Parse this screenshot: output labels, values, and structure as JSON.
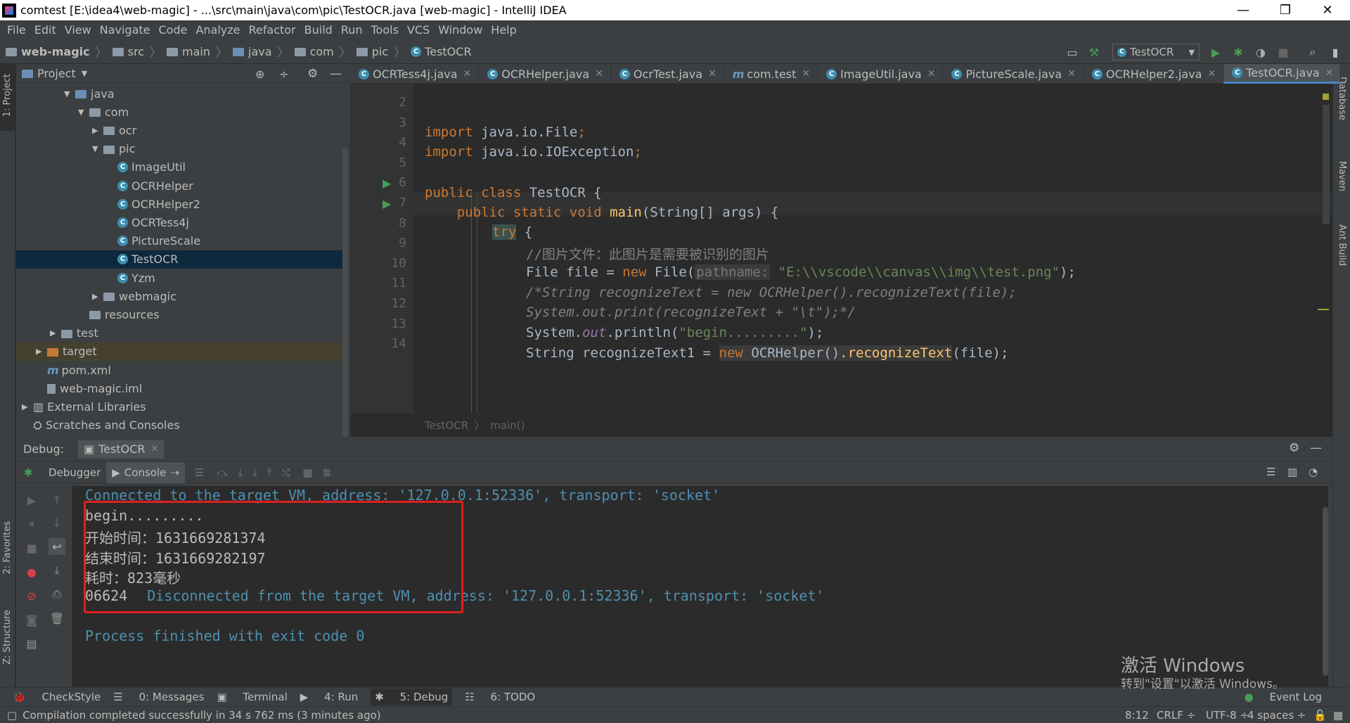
{
  "window": {
    "title": "comtest [E:\\idea4\\web-magic] - ...\\src\\main\\java\\com\\pic\\TestOCR.java [web-magic] - IntelliJ IDEA"
  },
  "menu": [
    "File",
    "Edit",
    "View",
    "Navigate",
    "Code",
    "Analyze",
    "Refactor",
    "Build",
    "Run",
    "Tools",
    "VCS",
    "Window",
    "Help"
  ],
  "breadcrumb": [
    "web-magic",
    "src",
    "main",
    "java",
    "com",
    "pic",
    "TestOCR"
  ],
  "run_config": "TestOCR",
  "left_stripe": {
    "project": "1: Project",
    "favorites": "2: Favorites",
    "structure": "Z: Structure"
  },
  "right_stripe": {
    "database": "Database",
    "maven": "Maven",
    "ant": "Ant Build"
  },
  "project_panel": {
    "title": "Project",
    "tree": [
      {
        "label": "java",
        "kind": "folder-blue",
        "indent": 3,
        "arrow": "▼"
      },
      {
        "label": "com",
        "kind": "folder",
        "indent": 4,
        "arrow": "▼"
      },
      {
        "label": "ocr",
        "kind": "folder",
        "indent": 5,
        "arrow": "▶"
      },
      {
        "label": "pic",
        "kind": "folder",
        "indent": 5,
        "arrow": "▼"
      },
      {
        "label": "ImageUtil",
        "kind": "class",
        "indent": 6,
        "arrow": ""
      },
      {
        "label": "OCRHelper",
        "kind": "class",
        "indent": 6,
        "arrow": ""
      },
      {
        "label": "OCRHelper2",
        "kind": "class",
        "indent": 6,
        "arrow": ""
      },
      {
        "label": "OCRTess4j",
        "kind": "class",
        "indent": 6,
        "arrow": ""
      },
      {
        "label": "PictureScale",
        "kind": "class",
        "indent": 6,
        "arrow": ""
      },
      {
        "label": "TestOCR",
        "kind": "class",
        "indent": 6,
        "arrow": "",
        "selected": true
      },
      {
        "label": "Yzm",
        "kind": "class",
        "indent": 6,
        "arrow": ""
      },
      {
        "label": "webmagic",
        "kind": "folder",
        "indent": 5,
        "arrow": "▶"
      },
      {
        "label": "resources",
        "kind": "folder",
        "indent": 4,
        "arrow": ""
      },
      {
        "label": "test",
        "kind": "folder",
        "indent": 2,
        "arrow": "▶"
      },
      {
        "label": "target",
        "kind": "folder-orange",
        "indent": 1,
        "arrow": "▶",
        "excluded": true
      },
      {
        "label": "pom.xml",
        "kind": "maven",
        "indent": 1,
        "arrow": ""
      },
      {
        "label": "web-magic.iml",
        "kind": "file",
        "indent": 1,
        "arrow": ""
      },
      {
        "label": "External Libraries",
        "kind": "lib",
        "indent": 0,
        "arrow": "▶"
      },
      {
        "label": "Scratches and Consoles",
        "kind": "scratch",
        "indent": 0,
        "arrow": ""
      }
    ]
  },
  "tabs": [
    {
      "label": "OCRTess4j.java",
      "icon": "class"
    },
    {
      "label": "OCRHelper.java",
      "icon": "class"
    },
    {
      "label": "OcrTest.java",
      "icon": "class"
    },
    {
      "label": "com.test",
      "icon": "maven"
    },
    {
      "label": "ImageUtil.java",
      "icon": "class"
    },
    {
      "label": "PictureScale.java",
      "icon": "class"
    },
    {
      "label": "OCRHelper2.java",
      "icon": "class"
    },
    {
      "label": "TestOCR.java",
      "icon": "class",
      "active": true
    }
  ],
  "editor": {
    "line_numbers": [
      "2",
      "3",
      "4",
      "5",
      "6",
      "7",
      "8",
      "9",
      "10",
      "11",
      "12",
      "13",
      "14"
    ],
    "code": {
      "l3a": "import ",
      "l3b": "java.io.File",
      "l3c": ";",
      "l4a": "import ",
      "l4b": "java.io.IOException",
      "l4c": ";",
      "l6a": "public class ",
      "l6b": "TestOCR {",
      "l7a": "    public static void ",
      "l7b": "main",
      "l7c": "(String[] args) {",
      "l8a": "try",
      "l8b": " {",
      "l9": "//图片文件：此图片是需要被识别的图片",
      "l10a": "File file = ",
      "l10b": "new ",
      "l10c": "File(",
      "l10d": "pathname:",
      "l10e": " \"E:\\\\vscode\\\\canvas\\\\img\\\\test.png\"",
      "l10f": ");",
      "l11": "/*String recognizeText = new OCRHelper().recognizeText(file);",
      "l12": "System.out.print(recognizeText + \"\\t\");*/",
      "l13a": "System.",
      "l13b": "out",
      "l13c": ".println(",
      "l13d": "\"begin.........\"",
      "l13e": ");",
      "l14a": "String recognizeText1 = ",
      "l14b": "new ",
      "l14c": "OCRHelper()",
      "l14d": ".recognizeText",
      "l14e": "(file);"
    },
    "crumb": [
      "TestOCR",
      "main()"
    ]
  },
  "debug": {
    "label": "Debug:",
    "session": "TestOCR",
    "tabs": {
      "debugger": "Debugger",
      "console": "Console"
    },
    "console": [
      {
        "text": "Connected to the target VM, address: '127.0.0.1:52336', transport: 'socket'",
        "style": "blue"
      },
      {
        "text": "begin.........",
        "style": "plain"
      },
      {
        "text": "开始时间：1631669281374",
        "style": "plain"
      },
      {
        "text": "结束时间：1631669282197",
        "style": "plain"
      },
      {
        "text": "耗时：823毫秒",
        "style": "plain"
      },
      {
        "text": "06624",
        "style": "plain",
        "tail": "Disconnected from the target VM, address: '127.0.0.1:52336', transport: 'socket'"
      },
      {
        "text": "",
        "style": "plain"
      },
      {
        "text": "Process finished with exit code 0",
        "style": "blue"
      }
    ]
  },
  "bottom_tools": [
    "CheckStyle",
    "0: Messages",
    "Terminal",
    "4: Run",
    "5: Debug",
    "6: TODO"
  ],
  "event_log": "Event Log",
  "status": {
    "message": "Compilation completed successfully in 34 s 762 ms (3 minutes ago)",
    "position": "8:12",
    "line_sep": "CRLF ÷",
    "encoding": "UTF-8 ÷",
    "indent": "4 spaces ÷"
  },
  "watermark": {
    "line1": "激活 Windows",
    "line2": "转到\"设置\"以激活 Windows。"
  },
  "colors": {
    "accent": "#4a88c7",
    "red_box": "#e0201e",
    "run_green": "#499c54"
  }
}
